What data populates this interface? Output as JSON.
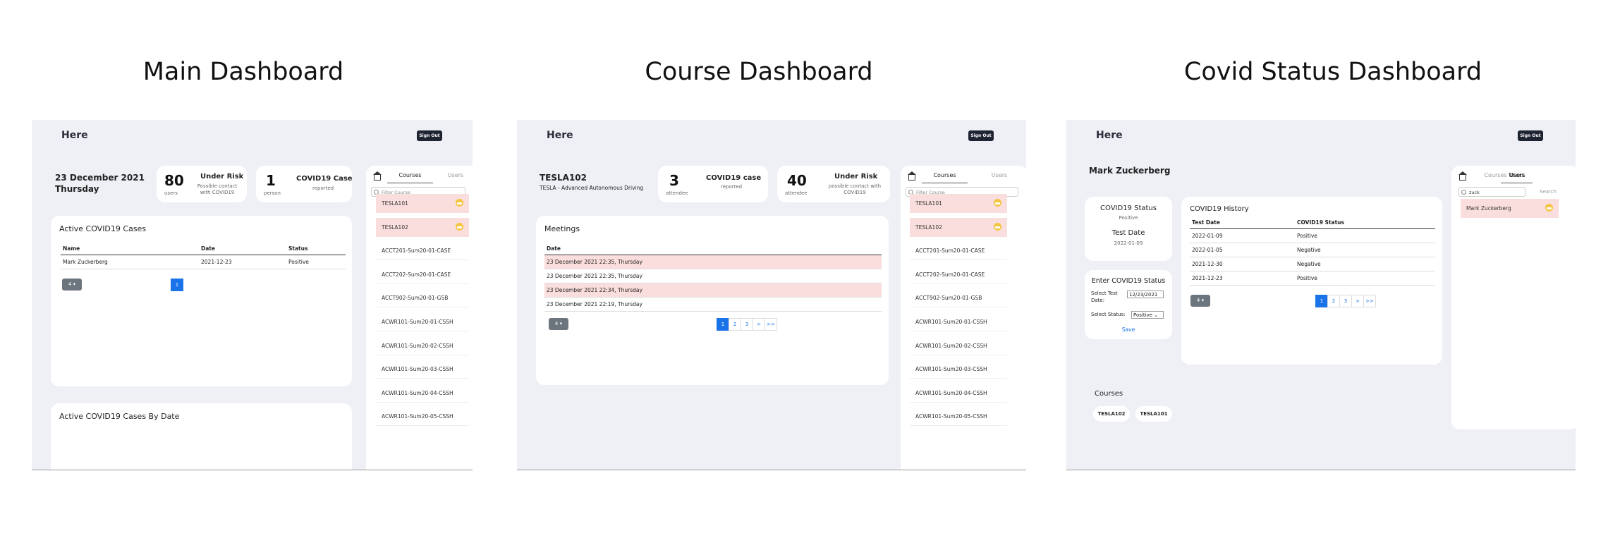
{
  "panel_titles": [
    "Main Dashboard",
    "Course Dashboard",
    "Covid Status Dashboard"
  ],
  "app": {
    "logo": "Here",
    "sign_out": "Sign Out"
  },
  "sidebar": {
    "tabs": [
      "Courses",
      "Users"
    ],
    "filter_placeholder": "Filter Course",
    "courses": [
      "TESLA101",
      "TESLA102",
      "ACCT201-Sum20-01-CASE",
      "ACCT202-Sum20-01-CASE",
      "ACCT902-Sum20-01-GSB",
      "ACWR101-Sum20-01-CSSH",
      "ACWR101-Sum20-02-CSSH",
      "ACWR101-Sum20-03-CSSH",
      "ACWR101-Sum20-04-CSSH",
      "ACWR101-Sum20-05-CSSH"
    ],
    "flagged_courses": [
      "TESLA101",
      "TESLA102"
    ]
  },
  "main": {
    "date": "23 December 2021",
    "weekday": "Thursday",
    "stat1": {
      "value": "80",
      "unit": "users",
      "label": "Under Risk",
      "desc": "Possible contact with COVID19"
    },
    "stat2": {
      "value": "1",
      "unit": "person",
      "label": "COVID19 Case",
      "desc": "reported"
    },
    "active_title": "Active COVID19 Cases",
    "columns": [
      "Name",
      "Date",
      "Status"
    ],
    "rows": [
      [
        "Mark Zuckerberg",
        "2021-12-23",
        "Positive"
      ]
    ],
    "page_size": "4",
    "pages": [
      "1"
    ],
    "by_date_title": "Active COVID19 Cases By Date"
  },
  "course": {
    "code": "TESLA102",
    "name": "TESLA - Advanced Autonomous Driving",
    "stat1": {
      "value": "3",
      "unit": "attendee",
      "label": "COVID19 case",
      "desc": "reported"
    },
    "stat2": {
      "value": "40",
      "unit": "attendee",
      "label": "Under Risk",
      "desc": "possible contact with COVID19"
    },
    "meetings_title": "Meetings",
    "column": "Date",
    "meetings": [
      "23 December 2021 22:35, Thursday",
      "23 December 2021 22:35, Thursday",
      "23 December 2021 22:34, Thursday",
      "23 December 2021 22:19, Thursday"
    ],
    "flagged": [
      0,
      2
    ],
    "page_size": "4",
    "pages": [
      "1",
      "2",
      "3",
      ">",
      ">>"
    ]
  },
  "covid": {
    "user": "Mark Zuckerberg",
    "status_title": "COVID19 Status",
    "status_value": "Positive",
    "test_date_title": "Test Date",
    "test_date_value": "2022-01-09",
    "enter_title": "Enter COVID19 Status",
    "select_date_label": "Select Test Date:",
    "date_input": "12/23/2021",
    "select_status_label": "Select Status:",
    "status_select": "Positive",
    "save": "Save",
    "history_title": "COVID19 History",
    "history_columns": [
      "Test Date",
      "COVID19 Status"
    ],
    "history": [
      [
        "2022-01-09",
        "Positive"
      ],
      [
        "2022-01-05",
        "Negative"
      ],
      [
        "2021-12-30",
        "Negative"
      ],
      [
        "2021-12-23",
        "Positive"
      ]
    ],
    "page_size": "4",
    "pages": [
      "1",
      "2",
      "3",
      ">",
      ">>"
    ],
    "courses_title": "Courses",
    "courses": [
      "TESLA102",
      "TESLA101"
    ],
    "users_search_value": "zuck",
    "users_search_button": "Search",
    "users": [
      "Mark Zuckerberg"
    ]
  },
  "colors": {
    "background": "#eef0f5",
    "flag_pink": "#fadedd",
    "accent_blue": "#1a73e8",
    "signout_dark": "#1f2433"
  }
}
